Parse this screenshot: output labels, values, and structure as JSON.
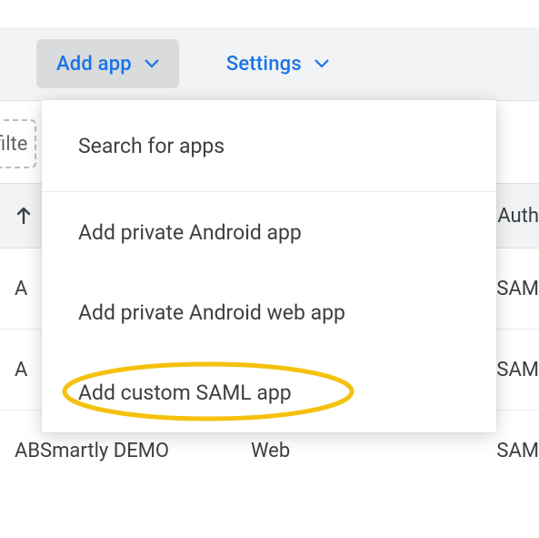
{
  "toolbar": {
    "add_app_label": "Add app",
    "settings_label": "Settings"
  },
  "filter": {
    "placeholder_fragment": "filte"
  },
  "columns": {
    "auth_fragment": "Auth"
  },
  "rows": [
    {
      "name_fragment": "A",
      "type": "",
      "auth_fragment": "SAM"
    },
    {
      "name_fragment": "A",
      "type": "",
      "auth_fragment": "SAM"
    },
    {
      "name_fragment": "ABSmartly DEMO",
      "type": "Web",
      "auth_fragment": "SAM"
    }
  ],
  "menu": {
    "search_label": "Search for apps",
    "add_private_android_label": "Add private Android app",
    "add_private_android_web_label": "Add private Android web app",
    "add_custom_saml_label": "Add custom SAML app"
  },
  "colors": {
    "accent": "#1a73e8",
    "highlight": "#f4c20d"
  }
}
